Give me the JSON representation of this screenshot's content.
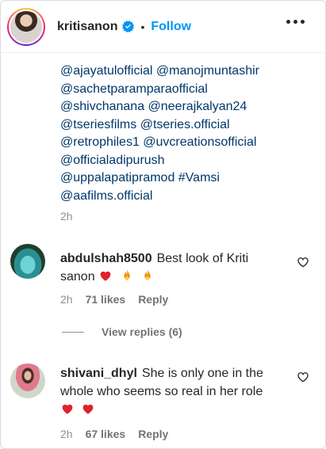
{
  "header": {
    "username": "kritisanon",
    "separator": "•",
    "follow_label": "Follow"
  },
  "caption": {
    "lines": [
      "@ajayatulofficial @manojmuntashir",
      "@sachetparamparaofficial",
      "@shivchanana @neerajkalyan24",
      "@tseriesfilms @tseries.official",
      "@retrophiles1 @uvcreationsofficial",
      "@officialadipurush",
      "@uppalapatipramod #Vamsi",
      "@aafilms.official"
    ],
    "time": "2h"
  },
  "comments": [
    {
      "username": "abdulshah8500",
      "text_line1": "Best look of Kriti",
      "text_line2": "sanon",
      "emojis": [
        "red-heart",
        "fire",
        "fire"
      ],
      "time": "2h",
      "likes": "71 likes",
      "reply_label": "Reply",
      "view_replies": "View replies (6)"
    },
    {
      "username": "shivani_dhyl",
      "text_line1": "She is only one in the",
      "text_line2": "whole who seems so real in her role",
      "emojis": [
        "red-heart",
        "red-heart"
      ],
      "time": "2h",
      "likes": "67 likes",
      "reply_label": "Reply"
    }
  ],
  "colors": {
    "link": "#00376b",
    "follow": "#0095f6",
    "secondary_text": "#8e8e8e",
    "heart_emoji": "#ed4956"
  }
}
